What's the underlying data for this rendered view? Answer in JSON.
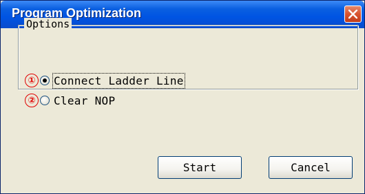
{
  "window": {
    "title": "Program Optimization"
  },
  "options_group": {
    "legend": "Options"
  },
  "options": [
    {
      "marker": "①",
      "label": "Connect Ladder Line",
      "checked": true
    },
    {
      "marker": "②",
      "label": "Clear NOP",
      "checked": false
    }
  ],
  "buttons": {
    "start": "Start",
    "cancel": "Cancel"
  },
  "colors": {
    "titlebar": "#0054e3",
    "marker": "#e00000",
    "face": "#ece9d8"
  },
  "icons": {
    "close": "close-icon"
  }
}
